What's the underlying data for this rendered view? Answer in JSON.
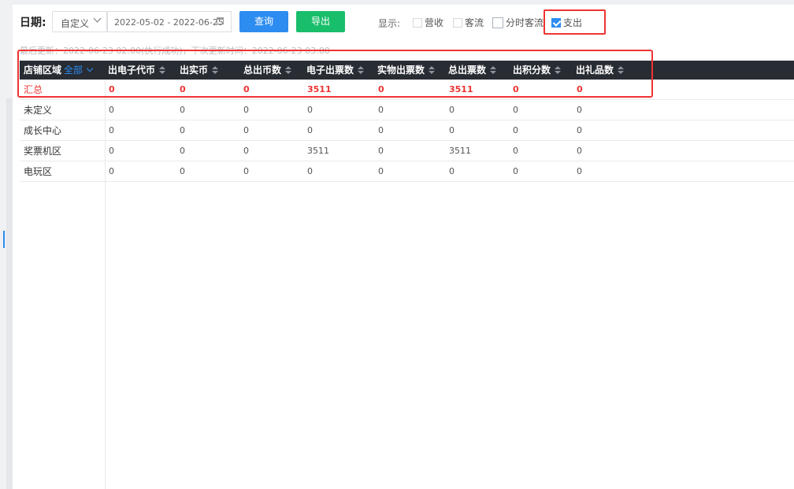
{
  "toolbar": {
    "date_label": "日期:",
    "range_type": "自定义",
    "date_range": "2022-05-02 - 2022-06-25",
    "query_button": "查询",
    "export_button": "导出",
    "show_label": "显示:",
    "options": [
      {
        "label": "营收",
        "checked": false
      },
      {
        "label": "客流",
        "checked": false
      },
      {
        "label": "分时客流",
        "checked": false
      },
      {
        "label": "支出",
        "checked": true
      }
    ]
  },
  "update_info": "最后更新：2022-06-23 02:00(执行成功)，下次更新时间：2022-06-23 03:00",
  "table": {
    "region_header": "店铺区域",
    "region_filter": "全部",
    "columns": [
      "出电子代币",
      "出实币",
      "总出币数",
      "电子出票数",
      "实物出票数",
      "总出票数",
      "出积分数",
      "出礼品数"
    ],
    "total_row": {
      "name": "汇总",
      "values": [
        "0",
        "0",
        "0",
        "3511",
        "0",
        "3511",
        "0",
        "0"
      ]
    },
    "rows": [
      {
        "name": "未定义",
        "values": [
          "0",
          "0",
          "0",
          "0",
          "0",
          "0",
          "0",
          "0"
        ]
      },
      {
        "name": "成长中心",
        "values": [
          "0",
          "0",
          "0",
          "0",
          "0",
          "0",
          "0",
          "0"
        ]
      },
      {
        "name": "奖票机区",
        "values": [
          "0",
          "0",
          "0",
          "3511",
          "0",
          "3511",
          "0",
          "0"
        ]
      },
      {
        "name": "电玩区",
        "values": [
          "0",
          "0",
          "0",
          "0",
          "0",
          "0",
          "0",
          "0"
        ]
      }
    ]
  },
  "colors": {
    "primary": "#2d8cf0",
    "success": "#19be6b",
    "header_bg": "#282c33",
    "highlight_red": "#e33333"
  }
}
